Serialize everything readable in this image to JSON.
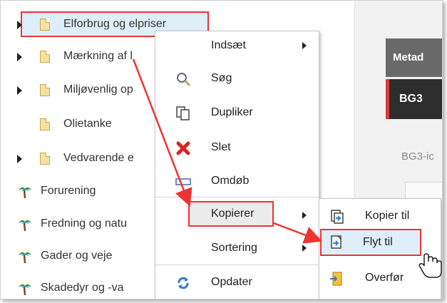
{
  "right_panel": {
    "meta_tab": "Metad",
    "bg3_tab": "BG3",
    "bg3_desc": "BG3-ic"
  },
  "tree": {
    "items": [
      {
        "label": "Elforbrug og elpriser",
        "icon": "page-icon",
        "expander": true
      },
      {
        "label": "Mærkning af l",
        "icon": "page-icon",
        "expander": true
      },
      {
        "label": "Miljøvenlig op",
        "icon": "page-icon",
        "expander": true
      },
      {
        "label": "Olietanke",
        "icon": "page-icon",
        "expander": false
      },
      {
        "label": "Vedvarende e",
        "icon": "page-icon",
        "expander": true
      },
      {
        "label": "Forurening",
        "icon": "palm-tree-icon",
        "expander": false
      },
      {
        "label": "Fredning og natu",
        "icon": "palm-tree-icon",
        "expander": false
      },
      {
        "label": "Gader og veje",
        "icon": "palm-tree-icon",
        "expander": false
      },
      {
        "label": "Skadedyr og -va",
        "icon": "palm-tree-icon",
        "expander": false
      }
    ]
  },
  "context_menu": {
    "items": [
      {
        "label": "Indsæt",
        "icon": "",
        "submenu": true
      },
      {
        "label": "Søg",
        "icon": "magnifier-icon",
        "submenu": false
      },
      {
        "label": "Dupliker",
        "icon": "duplicate-icon",
        "submenu": false
      },
      {
        "label": "Slet",
        "icon": "delete-x-icon",
        "submenu": false
      },
      {
        "label": "Omdøb",
        "icon": "rename-field-icon",
        "submenu": false
      },
      {
        "label": "Kopierer",
        "icon": "",
        "submenu": true
      },
      {
        "label": "Sortering",
        "icon": "",
        "submenu": true
      },
      {
        "label": "Opdater",
        "icon": "refresh-icon",
        "submenu": false
      }
    ]
  },
  "submenu": {
    "items": [
      {
        "label": "Kopier til",
        "icon": "copy-to-icon"
      },
      {
        "label": "Flyt til",
        "icon": "move-to-icon"
      },
      {
        "label": "Overfør",
        "icon": "transfer-icon"
      }
    ]
  },
  "colors": {
    "highlight_red": "#ee3333",
    "selection_blue": "#dfeefb",
    "meta_tab_bg": "#6a6a6a",
    "bg3_tab_bg": "#2d2d2d"
  }
}
